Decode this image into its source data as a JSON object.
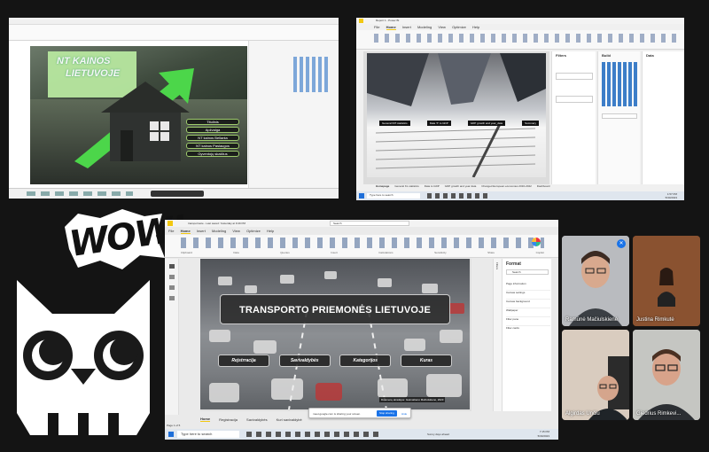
{
  "win1": {
    "slide": {
      "title_line1": "NT  KAINOS",
      "title_line2": "LIETUVOJE",
      "menu_items": [
        "Titulinis",
        "Apžvalga",
        "NT kainos Bellanta",
        "NT kainos Paslaugos",
        "Gyventojų skaičius"
      ]
    }
  },
  "win2": {
    "title": "Report 1 - Power BI",
    "menu": [
      "File",
      "Home",
      "Insert",
      "Modeling",
      "View",
      "Optimize",
      "Help"
    ],
    "filters_label": "Filters",
    "build_label": "Build",
    "data_label": "Data",
    "slide_buttons": [
      "General KPI statistics",
      "Data 'X' to GDP",
      "GDP growth and year_data",
      "Summary"
    ],
    "tabs": [
      "Homepage",
      "General KL statistics",
      "Data to GDP",
      "GDP growth and year data",
      "Changed European economies 2016-2022",
      "Dashboard"
    ],
    "search": "Type here to search",
    "time": "1:57 PM",
    "date": "5/30/2023"
  },
  "win3": {
    "title": "transportuote - Last saved: Yesterday at 9:49 PM",
    "search": "Search",
    "menu": [
      "File",
      "Home",
      "Insert",
      "Modeling",
      "View",
      "Optimize",
      "Help"
    ],
    "ribbon_groups": [
      "Clipboard",
      "Data",
      "Queries",
      "Insert",
      "Calculations",
      "Sensitivity",
      "Share",
      "Copilot"
    ],
    "slide": {
      "title": "TRANSPORTO PRIEMONĖS LIETUVOJE",
      "buttons": [
        "Rejstrracija",
        "Savivaldybės",
        "Kategorijos",
        "Kuras"
      ],
      "credit": "Duomenų atradėjos: Gaimaitienė Mačiulskienė, 2023"
    },
    "filters_label": "Filters",
    "format_panel": {
      "title": "Format",
      "search": "Search",
      "items": [
        "Page information",
        "Canvas settings",
        "Canvas background",
        "Wallpaper",
        "Filter pane",
        "Filter cards"
      ]
    },
    "tabs": [
      "Home",
      "Registracija",
      "Savivaldybės",
      "Kuri savivaldybė"
    ],
    "page_indicator": "Page 1 of 5",
    "share_bar": {
      "text": "meet.google.com is sharing your screen.",
      "stop": "Stop sharing",
      "hide": "Hide"
    },
    "taskbar_search": "Type here to search",
    "weather": "Sunny days ahead",
    "time": "7:15 PM",
    "date": "5/30/2023"
  },
  "sticker": {
    "wow_text": "WOW!"
  },
  "participants": [
    {
      "name": "Ramūnė Mačiulskienė",
      "muted": true
    },
    {
      "name": "Justina Rimkutė"
    },
    {
      "name": "Algirdas Unčiu"
    },
    {
      "name": "Giedrius Rimkevi..."
    }
  ],
  "colors": {
    "green": "#6fbf3a",
    "pbi_yellow": "#f2c811",
    "owl_dark": "#1a1a1a"
  }
}
